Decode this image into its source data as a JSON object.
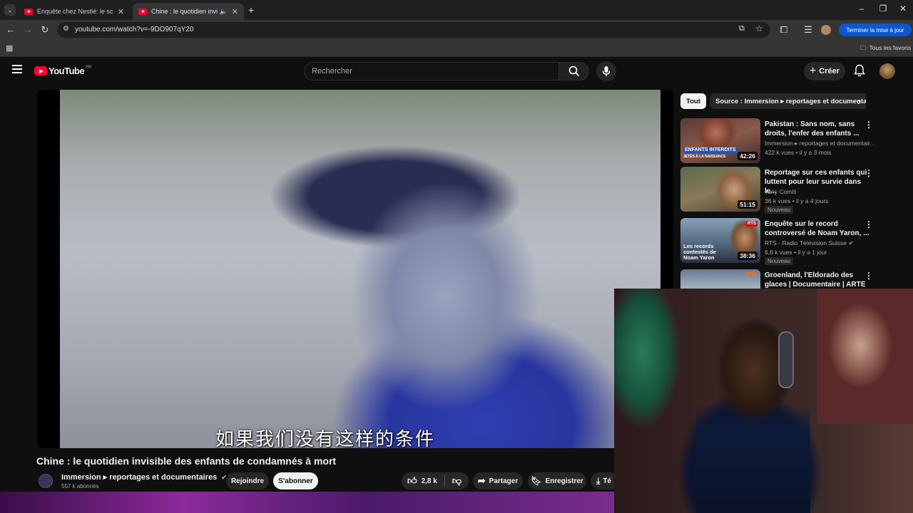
{
  "browser": {
    "tabs": [
      {
        "title": "Enquête chez Nestlé: le scanda",
        "active": false
      },
      {
        "title": "Chine : le quotidien invisible",
        "active": true
      }
    ],
    "new_tab": "+",
    "url": "youtube.com/watch?v=-9DO907qY20",
    "update_button": "Terminer la mise à jour",
    "bookmarks_folder": "Tous les favoris"
  },
  "youtube": {
    "logo_text": "YouTube",
    "region": "FR",
    "search_placeholder": "Rechercher",
    "create_label": "Créer"
  },
  "video": {
    "subtitle_cn": "如果我们没有这样的条件",
    "title": "Chine : le quotidien invisible des enfants de condamnés à mort",
    "channel": "Immersion ▸ reportages et documentaires",
    "subscribers": "557 k abonnés",
    "join_label": "Rejoindre",
    "subscribe_label": "S'abonner",
    "likes": "2,8 k",
    "share_label": "Partager",
    "save_label": "Enregistrer",
    "download_label": "Té"
  },
  "chips": [
    {
      "label": "Tout",
      "selected": true
    },
    {
      "label": "Source : Immersion ▸ reportages et documentaires",
      "selected": false
    }
  ],
  "recommendations": [
    {
      "title": "Pakistan : Sans nom, sans droits, l'enfer des enfants ...",
      "channel": "Immersion ▸ reportages et documentair...",
      "meta": "422 k vues • il y a 3 mois",
      "duration": "42:26",
      "thumb_label": "ENFANTS INTERDITS",
      "thumb_sub": "JETÉS À LA NAISSANCE",
      "badge": ""
    },
    {
      "title": "Reportage sur ces enfants qui luttent pour leur survie dans le...",
      "channel": "Tony Comiti",
      "meta": "36 k vues • il y a 4 jours",
      "duration": "51:15",
      "thumb_label": "",
      "thumb_sub": "",
      "badge": "Nouveau"
    },
    {
      "title": "Enquête sur le record controversé de Noam Yaron, ...",
      "channel": "RTS - Radio Télévision Suisse",
      "meta": "6,6 k vues • il y a 1 jour",
      "duration": "38:36",
      "thumb_label": "Les records contestés de Noam Yaron",
      "thumb_sub": "RTS",
      "badge": "Nouveau"
    },
    {
      "title": "Groenland, l'Eldorado des glaces | Documentaire | ARTE",
      "channel": "",
      "meta": "",
      "duration": "",
      "thumb_label": "arte",
      "thumb_sub": "",
      "badge": ""
    }
  ],
  "colors": {
    "yt_red": "#ff0033",
    "bg": "#0f0f0f",
    "accent_blue": "#0b57d0"
  }
}
